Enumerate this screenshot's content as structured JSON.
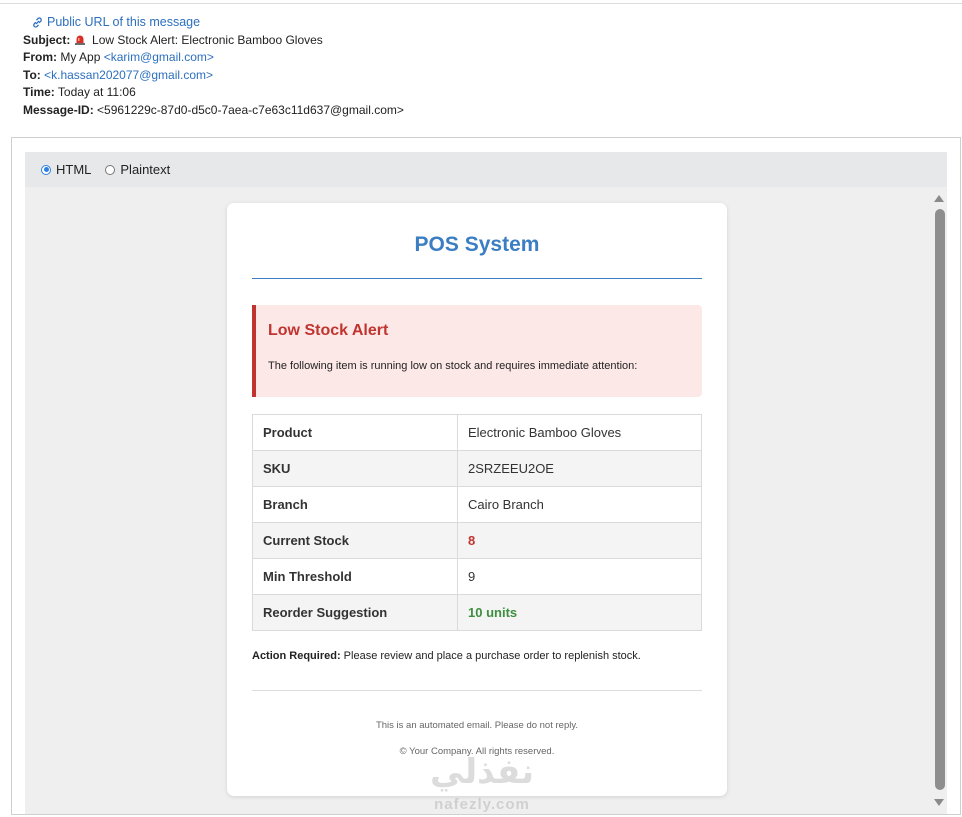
{
  "headers": {
    "public_url_label": "Public URL of this message",
    "subject_label": "Subject:",
    "subject_value": "Low Stock Alert: Electronic Bamboo Gloves",
    "from_label": "From:",
    "from_name": "My App",
    "from_email": "<karim@gmail.com>",
    "to_label": "To:",
    "to_email": "<k.hassan202077@gmail.com>",
    "time_label": "Time:",
    "time_value": "Today at 11:06",
    "message_id_label": "Message-ID:",
    "message_id_value": "<5961229c-87d0-d5c0-7aea-c7e63c11d637@gmail.com>"
  },
  "view_tabs": {
    "html_label": "HTML",
    "plaintext_label": "Plaintext",
    "selected": "HTML"
  },
  "email": {
    "brand_title": "POS System",
    "alert_title": "Low Stock Alert",
    "alert_text": "The following item is running low on stock and requires immediate attention:",
    "rows": [
      {
        "label": "Product",
        "value": "Electronic Bamboo Gloves"
      },
      {
        "label": "SKU",
        "value": "2SRZEEU2OE"
      },
      {
        "label": "Branch",
        "value": "Cairo Branch"
      },
      {
        "label": "Current Stock",
        "value": "8"
      },
      {
        "label": "Min Threshold",
        "value": "9"
      },
      {
        "label": "Reorder Suggestion",
        "value": "10 units"
      }
    ],
    "action_label": "Action Required:",
    "action_text": " Please review and place a purchase order to replenish stock.",
    "footer_line_1": "This is an automated email. Please do not reply.",
    "footer_line_2": "© Your Company. All rights reserved."
  },
  "watermark": {
    "arabic": "نفذلي",
    "latin": "nafezly.com"
  },
  "colors": {
    "brand_blue": "#3b7ec3",
    "alert_red": "#c0342f",
    "alert_bg": "#fde8e8",
    "success_green": "#3e8e41",
    "link_blue": "#2c6fbe"
  }
}
